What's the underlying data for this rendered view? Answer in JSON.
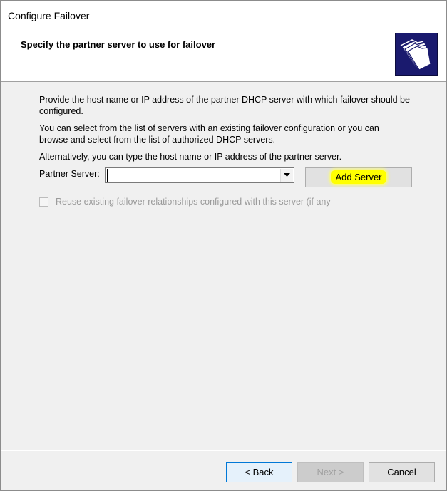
{
  "window": {
    "title": "Configure Failover"
  },
  "header": {
    "heading": "Specify the partner server to use for failover",
    "icon": "folders-icon"
  },
  "content": {
    "paragraph1": "Provide the host name or IP address of the partner DHCP server with which failover should be configured.",
    "paragraph2": "You can select from the list of servers with an existing failover configuration or you can browse and select from the list of authorized DHCP servers.",
    "paragraph3": "Alternatively, you can type the host name or IP address of the partner server."
  },
  "partner_server": {
    "label": "Partner Server:",
    "value": "",
    "add_button_label": "Add Server"
  },
  "reuse_checkbox": {
    "label": "Reuse existing failover relationships configured with this server (if any",
    "checked": false,
    "enabled": false
  },
  "footer": {
    "back_label": "< Back",
    "next_label": "Next >",
    "cancel_label": "Cancel"
  },
  "colors": {
    "highlight": "#ffff00",
    "icon_background": "#1a1a6e",
    "dialog_background": "#f0f0f0",
    "disabled_text": "#9a9a9a",
    "focus_border": "#0078d7"
  }
}
